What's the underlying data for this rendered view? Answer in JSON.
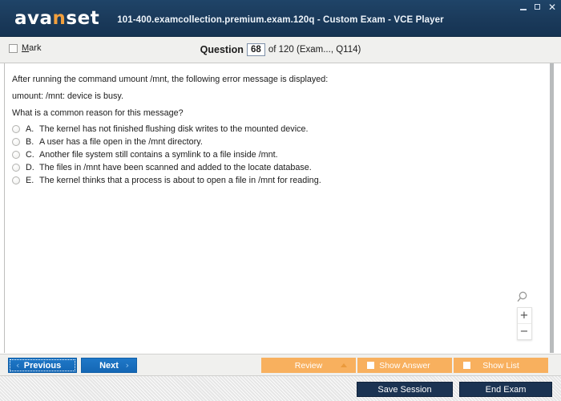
{
  "titlebar": {
    "logo_text_1": "ava",
    "logo_accent": "n",
    "logo_text_2": "set",
    "window_title": "101-400.examcollection.premium.exam.120q - Custom Exam - VCE Player",
    "minimize_icon": "minimize-icon",
    "maximize_icon": "maximize-icon",
    "close_icon": "close-icon",
    "close_glyph": "✕",
    "bg_color": "#1b3b5c",
    "accent_color": "#f2a03d"
  },
  "question_header": {
    "mark_label_prefix": "M",
    "mark_label_rest": "ark",
    "counter_label": "Question",
    "question_number": "68",
    "counter_rest": "of 120 (Exam..., Q114)"
  },
  "question": {
    "line1": "After running the command umount /mnt, the following error message is displayed:",
    "line2": "umount: /mnt: device is busy.",
    "line3": "What is a common reason for this message?",
    "options": [
      {
        "letter": "A.",
        "text": "The kernel has not finished flushing disk writes to the mounted device."
      },
      {
        "letter": "B.",
        "text": "A user has a file open in the /mnt directory."
      },
      {
        "letter": "C.",
        "text": "Another file system still contains a symlink to a file inside /mnt."
      },
      {
        "letter": "D.",
        "text": "The files in /mnt have been scanned and added to the locate database."
      },
      {
        "letter": "E.",
        "text": "The kernel thinks that a process is about to open a file in /mnt for reading."
      }
    ]
  },
  "zoom_controls": {
    "magnifier_icon": "magnifier-icon",
    "zoom_in_label": "+",
    "zoom_out_label": "−"
  },
  "toolbar": {
    "previous_label": "Previous",
    "previous_chevron": "‹",
    "next_label": "Next",
    "next_chevron": "›",
    "review_label": "Review",
    "show_answer_label": "Show Answer",
    "show_list_label": "Show List",
    "orange_color": "#f8b05e",
    "blue_color": "#1467b4"
  },
  "footer": {
    "save_session_label": "Save Session",
    "end_exam_label": "End Exam",
    "dark_color": "#1b3352"
  }
}
